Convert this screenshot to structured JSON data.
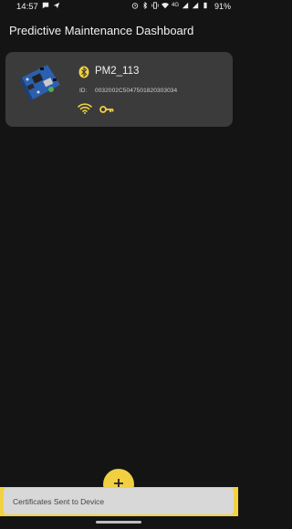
{
  "status_bar": {
    "time": "14:57",
    "battery": "91%",
    "network_label": "4G",
    "left_icons": [
      "chat-icon",
      "location-arrow-icon"
    ],
    "right_icons": [
      "alarm-icon",
      "bluetooth-icon",
      "vibrate-icon",
      "wifi-icon",
      "signal-icon",
      "signal-icon"
    ]
  },
  "header": {
    "title": "Predictive Maintenance Dashboard"
  },
  "device": {
    "name": "PM2_113",
    "id_label": "ID:",
    "id_value": "0032002C5047501820303034",
    "icons": [
      "bluetooth-icon",
      "wifi-icon",
      "key-icon"
    ]
  },
  "snackbar": {
    "message": "Certificates Sent to Device"
  },
  "colors": {
    "background": "#141414",
    "card": "#3b3b3b",
    "accent": "#f0d040"
  }
}
